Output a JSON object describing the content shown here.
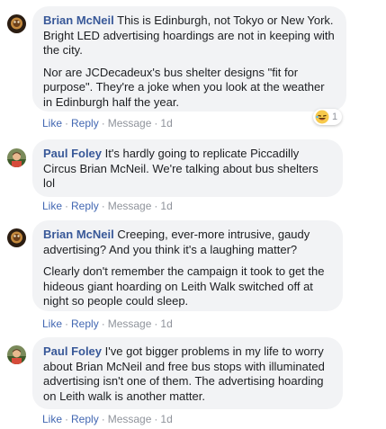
{
  "comments": [
    {
      "author": "Brian McNeil",
      "paragraphs": [
        "This is Edinburgh, not Tokyo or New York. Bright LED advertising hoardings are not in keeping with the city.",
        "Nor are JCDecadeux's bus shelter designs \"fit for purpose\". They're a joke when you look at the weather in Edinburgh half the year."
      ],
      "actions": {
        "like": "Like",
        "reply": "Reply",
        "message": "Message",
        "time": "1d"
      },
      "reaction": {
        "icon": "laughing-emoji-icon",
        "count": "1"
      }
    },
    {
      "author": "Paul Foley",
      "paragraphs": [
        "It's hardly going to replicate Piccadilly Circus Brian McNeil. We're talking about bus shelters lol"
      ],
      "actions": {
        "like": "Like",
        "reply": "Reply",
        "message": "Message",
        "time": "1d"
      }
    },
    {
      "author": "Brian McNeil",
      "paragraphs": [
        "Creeping, ever-more intrusive, gaudy advertising? And you think it's a laughing matter?",
        "Clearly don't remember the campaign it took to get the hideous giant hoarding on Leith Walk switched off at night so people could sleep."
      ],
      "actions": {
        "like": "Like",
        "reply": "Reply",
        "message": "Message",
        "time": "1d"
      }
    },
    {
      "author": "Paul Foley",
      "paragraphs": [
        "I've got bigger problems in my life to worry about Brian McNeil and free bus stops with illuminated advertising isn't one of them. The advertising hoarding on Leith walk is another matter."
      ],
      "actions": {
        "like": "Like",
        "reply": "Reply",
        "message": "Message",
        "time": "1d"
      }
    }
  ],
  "separator": "·",
  "colors": {
    "author": "#385898",
    "link": "#4267b2",
    "muted": "#90949c",
    "bubble": "#f2f3f5"
  }
}
